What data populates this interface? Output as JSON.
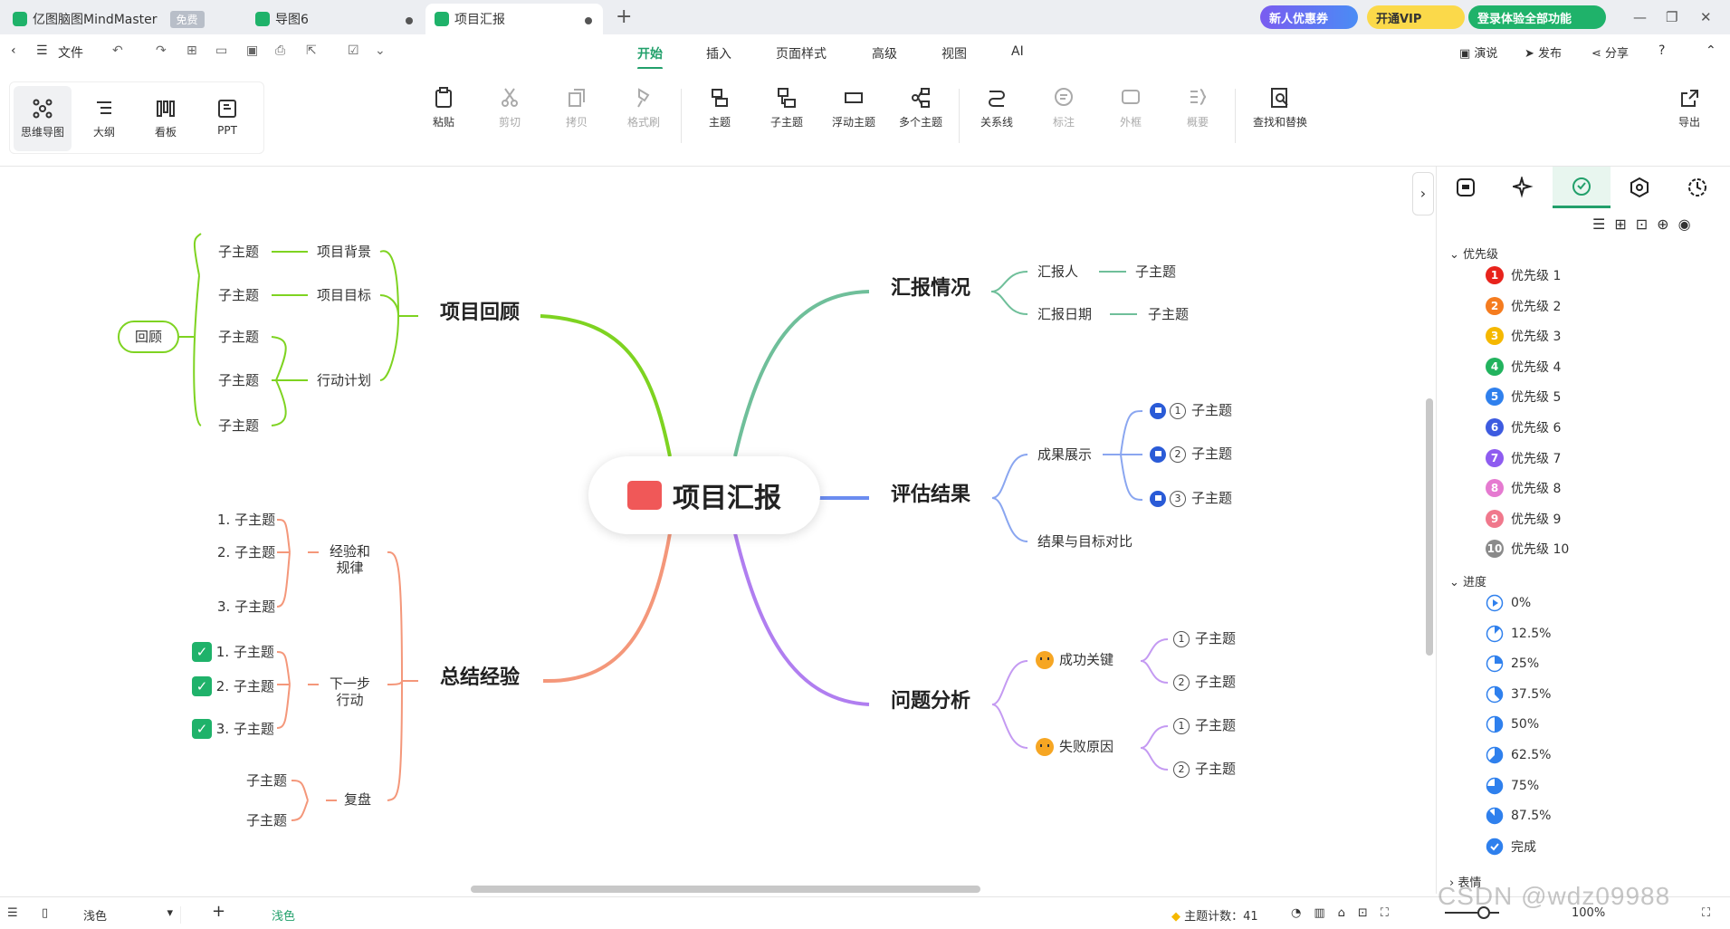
{
  "titlebar": {
    "app_tab": "亿图脑图MindMaster",
    "free_badge": "免费",
    "tab2": "导图6",
    "tab3": "项目汇报",
    "promo": "新人优惠券",
    "vip": "开通VIP",
    "login": "登录体验全部功能"
  },
  "menubar": {
    "file": "文件",
    "tabs": [
      "开始",
      "插入",
      "页面样式",
      "高级",
      "视图",
      "AI"
    ],
    "right": [
      "演说",
      "发布",
      "分享"
    ]
  },
  "ribbon": {
    "views": [
      "思维导图",
      "大纲",
      "看板",
      "PPT"
    ],
    "tools": [
      "粘贴",
      "剪切",
      "拷贝",
      "格式刷",
      "主题",
      "子主题",
      "浮动主题",
      "多个主题",
      "关系线",
      "标注",
      "外框",
      "概要",
      "查找和替换"
    ],
    "export": "导出"
  },
  "mindmap": {
    "root": "项目汇报",
    "review": {
      "title": "项目回顾",
      "summary": "回顾",
      "items": [
        "项目背景",
        "项目目标",
        "行动计划"
      ],
      "sub": "子主题"
    },
    "report": {
      "title": "汇报情况",
      "items": [
        "汇报人",
        "汇报日期"
      ],
      "sub": "子主题"
    },
    "evaluate": {
      "title": "评估结果",
      "items": [
        "成果展示",
        "结果与目标对比"
      ],
      "nums": [
        "1",
        "2",
        "3"
      ],
      "sub": "子主题"
    },
    "summary": {
      "title": "总结经验",
      "items": [
        "经验和规律",
        "下一步行动",
        "复盘"
      ],
      "exp_line1": "经验和",
      "exp_line2": "规律",
      "next_line1": "下一步",
      "next_line2": "行动",
      "numbered": [
        "1. 子主题",
        "2. 子主题",
        "3. 子主题"
      ],
      "sub": "子主题",
      "check": "✓"
    },
    "problem": {
      "title": "问题分析",
      "items": [
        "成功关键",
        "失败原因"
      ],
      "nums": [
        "1",
        "2"
      ],
      "sub": "子主题"
    }
  },
  "panel": {
    "priority_title": "优先级",
    "priorities": [
      "优先级 1",
      "优先级 2",
      "优先级 3",
      "优先级 4",
      "优先级 5",
      "优先级 6",
      "优先级 7",
      "优先级 8",
      "优先级 9",
      "优先级 10"
    ],
    "priority_nums": [
      "1",
      "2",
      "3",
      "4",
      "5",
      "6",
      "7",
      "8",
      "9",
      "10"
    ],
    "priority_colors": [
      "#e8231c",
      "#f57c1f",
      "#f5b800",
      "#22b35e",
      "#2f80ed",
      "#3d5be0",
      "#8e5cf0",
      "#e57ad0",
      "#f0788c",
      "#8a8a8a"
    ],
    "progress_title": "进度",
    "progress": [
      "0%",
      "12.5%",
      "25%",
      "37.5%",
      "50%",
      "62.5%",
      "75%",
      "87.5%",
      "完成"
    ],
    "progress_values": [
      0,
      0.125,
      0.25,
      0.375,
      0.5,
      0.625,
      0.75,
      0.875,
      1
    ],
    "expression_title": "表情"
  },
  "statusbar": {
    "theme": "浅色",
    "theme_tab": "浅色",
    "topic_count": "主题计数：41",
    "zoom": "100%"
  },
  "watermark": "CSDN @wdz09988"
}
